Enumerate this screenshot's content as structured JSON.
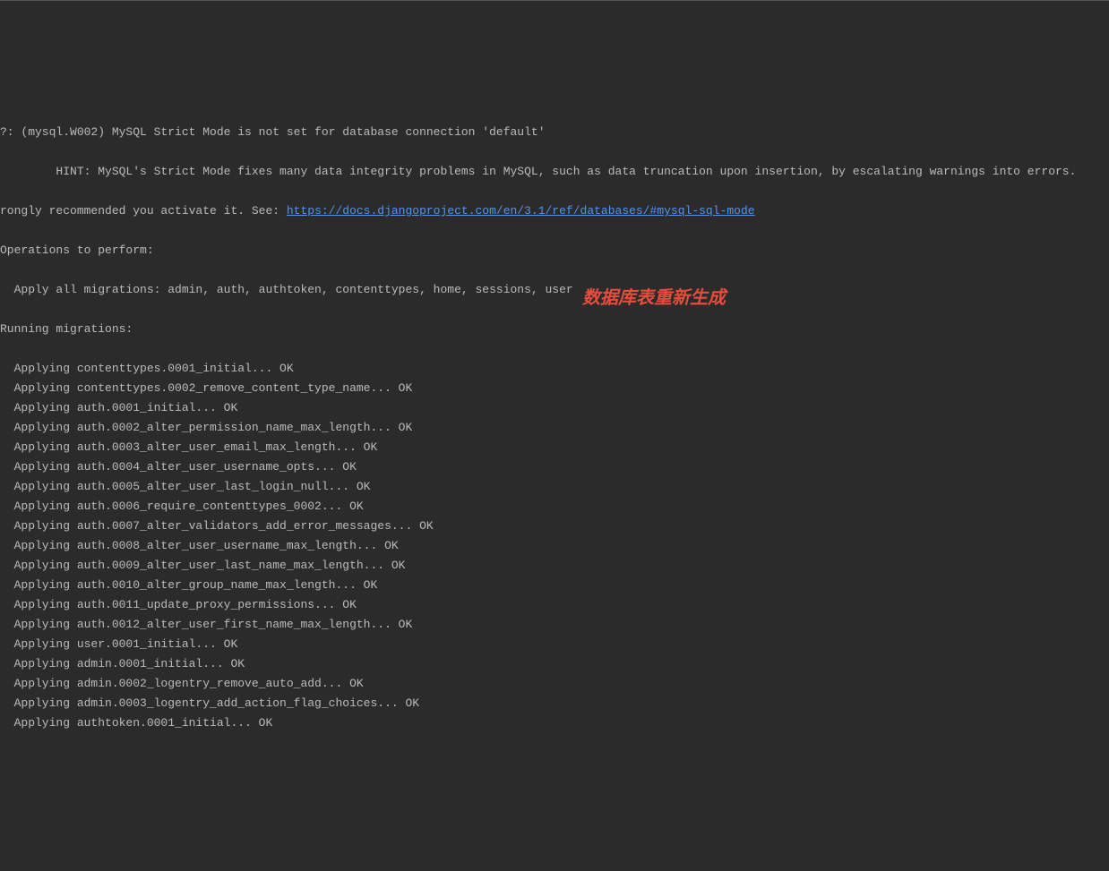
{
  "terminal": {
    "warning_line": "?: (mysql.W002) MySQL Strict Mode is not set for database connection 'default'",
    "hint_prefix": "        HINT: MySQL's Strict Mode fixes many data integrity problems in MySQL, such as data truncation upon insertion, by escalating warnings into errors.",
    "hint_line2_prefix": "rongly recommended you activate it. See: ",
    "hint_link": "https://docs.djangoproject.com/en/3.1/ref/databases/#mysql-sql-mode",
    "operations_header": "Operations to perform:",
    "apply_all": "  Apply all migrations: admin, auth, authtoken, contenttypes, home, sessions, user",
    "running_header": "Running migrations:",
    "migrations": [
      "  Applying contenttypes.0001_initial... OK",
      "  Applying contenttypes.0002_remove_content_type_name... OK",
      "  Applying auth.0001_initial... OK",
      "  Applying auth.0002_alter_permission_name_max_length... OK",
      "  Applying auth.0003_alter_user_email_max_length... OK",
      "  Applying auth.0004_alter_user_username_opts... OK",
      "  Applying auth.0005_alter_user_last_login_null... OK",
      "  Applying auth.0006_require_contenttypes_0002... OK",
      "  Applying auth.0007_alter_validators_add_error_messages... OK",
      "  Applying auth.0008_alter_user_username_max_length... OK",
      "  Applying auth.0009_alter_user_last_name_max_length... OK",
      "  Applying auth.0010_alter_group_name_max_length... OK",
      "  Applying auth.0011_update_proxy_permissions... OK",
      "  Applying auth.0012_alter_user_first_name_max_length... OK",
      "  Applying user.0001_initial... OK",
      "  Applying admin.0001_initial... OK",
      "  Applying admin.0002_logentry_remove_auto_add... OK",
      "  Applying admin.0003_logentry_add_action_flag_choices... OK",
      "  Applying authtoken.0001_initial... OK"
    ]
  },
  "annotation": {
    "text": "数据库表重新生成"
  }
}
